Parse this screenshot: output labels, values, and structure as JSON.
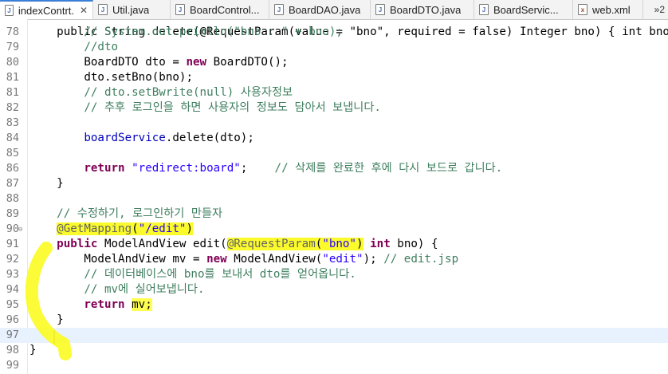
{
  "tabs": [
    {
      "label": "indexContrt...",
      "icon": "java-file-icon",
      "active": true,
      "close": "✕"
    },
    {
      "label": "Util.java",
      "icon": "java-file-icon"
    },
    {
      "label": "BoardControl...",
      "icon": "java-file-icon"
    },
    {
      "label": "BoardDAO.java",
      "icon": "java-file-icon"
    },
    {
      "label": "BoardDTO.java",
      "icon": "java-file-icon"
    },
    {
      "label": "BoardServic...",
      "icon": "java-file-icon"
    },
    {
      "label": "web.xml",
      "icon": "xml-file-icon"
    }
  ],
  "tab_overflow": "»2",
  "lines": [
    {
      "n": "78",
      "text": "        // System.out.println(\"bno : \" + bno);"
    },
    {
      "n": "79",
      "text": "        //dto"
    },
    {
      "n": "80",
      "text": "        BoardDTO dto = new BoardDTO();"
    },
    {
      "n": "81",
      "text": "        dto.setBno(bno);"
    },
    {
      "n": "81",
      "text": "        // dto.setBwrite(null) 사용자정보"
    },
    {
      "n": "82",
      "text": "        // 추후 로그인을 하면 사용자의 정보도 담아서 보냅니다."
    },
    {
      "n": "83",
      "text": ""
    },
    {
      "n": "84",
      "text": "        boardService.delete(dto);"
    },
    {
      "n": "85",
      "text": ""
    },
    {
      "n": "86",
      "text": "        return \"redirect:board\";    // 삭제를 완료한 후에 다시 보드로 갑니다."
    },
    {
      "n": "87",
      "text": "    }"
    },
    {
      "n": "88",
      "text": ""
    },
    {
      "n": "89",
      "text": "    // 수정하기, 로그인하기 만들자"
    },
    {
      "n": "90",
      "text": "    @GetMapping(\"/edit\")"
    },
    {
      "n": "91",
      "text": "    public ModelAndView edit(@RequestParam(\"bno\") int bno) {"
    },
    {
      "n": "92",
      "text": "        ModelAndView mv = new ModelAndView(\"edit\"); // edit.jsp"
    },
    {
      "n": "93",
      "text": "        // 데이터베이스에 bno를 보내서 dto를 얻어옵니다."
    },
    {
      "n": "94",
      "text": "        // mv에 실어보냅니다."
    },
    {
      "n": "95",
      "text": "        return mv;"
    },
    {
      "n": "96",
      "text": "    }"
    },
    {
      "n": "97",
      "text": ""
    },
    {
      "n": "98",
      "text": "}"
    },
    {
      "n": "99",
      "text": ""
    }
  ],
  "partial_top_line": "    public String delete(@RequestParam(value = \"bno\", required = false) Integer bno) { int bno",
  "colors": {
    "keyword": "#7f0055",
    "string": "#2a00ff",
    "comment": "#3f7f5f",
    "annotation": "#646464",
    "field": "#0000c0",
    "highlight": "#fbfb2c",
    "current_line": "#e8f2fe"
  }
}
